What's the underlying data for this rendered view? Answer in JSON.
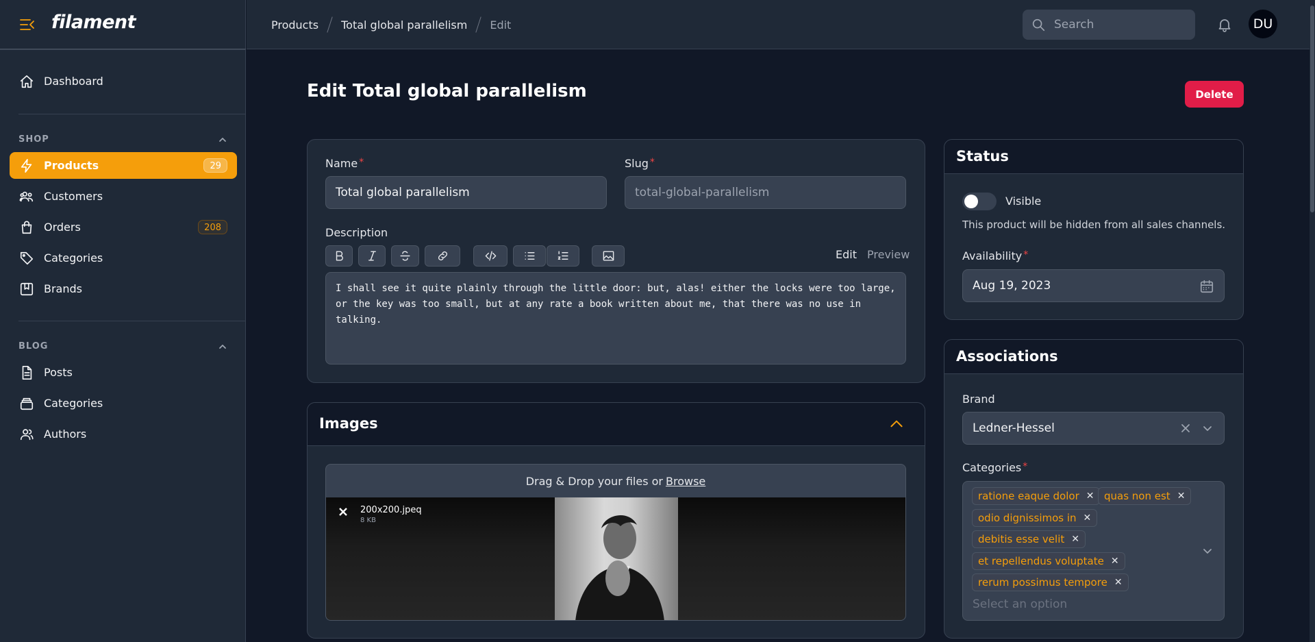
{
  "app": {
    "logo": "filament"
  },
  "sidebar": {
    "items_top": [
      {
        "label": "Dashboard",
        "icon": "home-icon"
      }
    ],
    "groups": [
      {
        "label": "SHOP",
        "items": [
          {
            "label": "Products",
            "icon": "bolt-icon",
            "badge": "29",
            "active": true
          },
          {
            "label": "Customers",
            "icon": "users-icon"
          },
          {
            "label": "Orders",
            "icon": "shopping-bag-icon",
            "badge": "208"
          },
          {
            "label": "Categories",
            "icon": "tag-icon"
          },
          {
            "label": "Brands",
            "icon": "bookmark-square-icon"
          }
        ]
      },
      {
        "label": "BLOG",
        "items": [
          {
            "label": "Posts",
            "icon": "document-text-icon"
          },
          {
            "label": "Categories",
            "icon": "rectangle-stack-icon"
          },
          {
            "label": "Authors",
            "icon": "user-group-icon"
          }
        ]
      }
    ]
  },
  "topbar": {
    "breadcrumbs": [
      "Products",
      "Total global parallelism",
      "Edit"
    ],
    "search_placeholder": "Search",
    "avatar_initials": "DU"
  },
  "page": {
    "title": "Edit Total global parallelism",
    "delete_label": "Delete"
  },
  "form": {
    "name_label": "Name",
    "name_value": "Total global parallelism",
    "slug_label": "Slug",
    "slug_value": "total-global-parallelism",
    "description_label": "Description",
    "editor_modes": [
      "Edit",
      "Preview"
    ],
    "description_value": "I shall see it quite plainly through the little door: but, alas! either the locks were too large, or the key was too small, but at any rate a book written about me, that there was no use in talking."
  },
  "images": {
    "title": "Images",
    "dropzone_text": "Drag & Drop your files or",
    "browse_label": "Browse",
    "file": {
      "name": "200x200.jpeq",
      "size": "8 KB"
    }
  },
  "status": {
    "title": "Status",
    "visible_label": "Visible",
    "visible_on": false,
    "visible_help": "This product will be hidden from all sales channels.",
    "availability_label": "Availability",
    "availability_value": "Aug 19, 2023"
  },
  "associations": {
    "title": "Associations",
    "brand_label": "Brand",
    "brand_value": "Ledner-Hessel",
    "categories_label": "Categories",
    "categories": [
      "ratione eaque dolor",
      "quas non est",
      "odio dignissimos in",
      "debitis esse velit",
      "et repellendus voluptate",
      "rerum possimus tempore"
    ],
    "categories_placeholder": "Select an option"
  },
  "colors": {
    "accent": "#f59e0b",
    "danger": "#e11d48",
    "bg": "#111827",
    "panel": "#1f2937"
  }
}
